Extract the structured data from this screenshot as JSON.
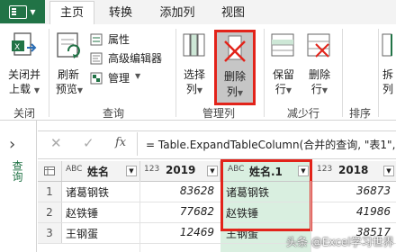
{
  "tabs": [
    {
      "label": "主页",
      "active": true
    },
    {
      "label": "转换",
      "active": false
    },
    {
      "label": "添加列",
      "active": false
    },
    {
      "label": "视图",
      "active": false
    }
  ],
  "ribbon": {
    "close_load_line1": "关闭并",
    "close_load_line2": "上载",
    "refresh_line1": "刷新",
    "refresh_line2": "预览",
    "properties": "属性",
    "advanced_editor": "高级编辑器",
    "manage": "管理",
    "choose_cols_line1": "选择",
    "choose_cols_line2": "列",
    "remove_cols_line1": "删除",
    "remove_cols_line2": "列",
    "keep_rows_line1": "保留",
    "keep_rows_line2": "行",
    "remove_rows_line1": "删除",
    "remove_rows_line2": "行",
    "split_line1": "拆",
    "split_line2": "列",
    "groups": {
      "close": "关闭",
      "query": "查询",
      "manage_cols": "管理列",
      "reduce_rows": "减少行",
      "sort": "排序"
    }
  },
  "sidebar": {
    "expand_glyph": "›",
    "label": "查询"
  },
  "formula_bar": {
    "cancel_glyph": "✕",
    "confirm_glyph": "✓",
    "fx_label": "fx",
    "formula": "= Table.ExpandTableColumn(合并的查询, \"表1\","
  },
  "table": {
    "columns": [
      {
        "type_icon": "ABC",
        "name": "姓名"
      },
      {
        "type_icon": "123",
        "name": "2019"
      },
      {
        "type_icon": "ABC",
        "name": "姓名.1"
      },
      {
        "type_icon": "123",
        "name": "2018"
      }
    ],
    "rows": [
      {
        "num": "1",
        "cells": [
          "诸葛钢铁",
          "83628",
          "诸葛钢铁",
          "36873"
        ]
      },
      {
        "num": "2",
        "cells": [
          "赵铁锤",
          "77682",
          "赵铁锤",
          "41986"
        ]
      },
      {
        "num": "3",
        "cells": [
          "王钢蛋",
          "12469",
          "王钢蛋",
          "38517"
        ]
      }
    ]
  },
  "watermark": "头条 @Excel学习世界",
  "colors": {
    "accent_green": "#217346",
    "highlight_red": "#e2231a",
    "selected_col": "#d9efe0"
  }
}
